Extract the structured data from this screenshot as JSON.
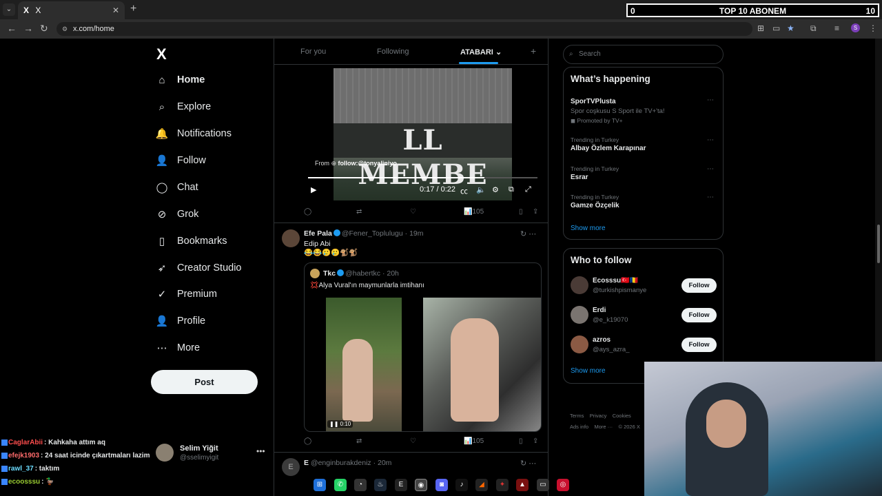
{
  "browser": {
    "tab_title": "X",
    "tab_logo": "X",
    "url": "x.com/home",
    "tab_close": "✕",
    "new_tab": "+",
    "icons": [
      "back-icon",
      "forward-icon",
      "reload-icon",
      "translate-icon",
      "cast-icon",
      "star-icon",
      "extensions-icon",
      "reading-list-icon",
      "profile-icon",
      "menu-icon"
    ]
  },
  "stream_overlay": {
    "left_value": "0",
    "title": "TOP 10 ABONEM",
    "right_value": "10"
  },
  "sidebar": {
    "logo": "X",
    "items": [
      {
        "label": "Home",
        "icon": "home-icon"
      },
      {
        "label": "Explore",
        "icon": "search-icon"
      },
      {
        "label": "Notifications",
        "icon": "bell-icon"
      },
      {
        "label": "Follow",
        "icon": "add-person-icon"
      },
      {
        "label": "Chat",
        "icon": "chat-icon"
      },
      {
        "label": "Grok",
        "icon": "grok-icon"
      },
      {
        "label": "Bookmarks",
        "icon": "bookmark-icon"
      },
      {
        "label": "Creator Studio",
        "icon": "rocket-icon"
      },
      {
        "label": "Premium",
        "icon": "verified-icon"
      },
      {
        "label": "Profile",
        "icon": "person-icon"
      },
      {
        "label": "More",
        "icon": "more-circle-icon"
      }
    ],
    "post_label": "Post",
    "account": {
      "name": "Selim Yiğit",
      "handle": "@sselimyigit",
      "dots": "•••"
    }
  },
  "feed": {
    "tabs": [
      "For you",
      "Following",
      "ATABARI"
    ],
    "tab_plus": "+",
    "video": {
      "banner": "LL MEMBE",
      "from_prefix": "From",
      "from_user": "follow:@tonyaliniyo",
      "time": "0:17 / 0:22",
      "progress": 0.77
    },
    "post1_actions": {
      "views": "105"
    },
    "post2": {
      "name": "Efe Pala",
      "handle": "@Fener_Toplulugu · 19m",
      "text": "Edip Abi",
      "emojis": "😂😂🥲🥲🐒🐒",
      "quote": {
        "name": "Tkc",
        "handle": "@habertkc · 20h",
        "text": "💢Alya Vural'ın maymunlarla imtihanı",
        "video_time": "0:10"
      },
      "views": "105"
    },
    "post3": {
      "name": "E",
      "handle": "@enginburakdeniz · 20m"
    }
  },
  "right": {
    "search_placeholder": "Search",
    "happening_title": "What’s happening",
    "trends": [
      {
        "context": "",
        "title": "SporTVPlusta",
        "sub": "Spor coşkusu S Sport ile TV+'ta!",
        "promo": "Promoted by TV+"
      },
      {
        "context": "Trending in Turkey",
        "title": "Albay Özlem Karapınar"
      },
      {
        "context": "Trending in Turkey",
        "title": "Esrar"
      },
      {
        "context": "Trending in Turkey",
        "title": "Gamze Özçelik"
      }
    ],
    "show_more": "Show more",
    "wtf_title": "Who to follow",
    "wtf": [
      {
        "name": "Ecosssu🇹🇷🇷🇴",
        "handle": "@turkishpismanye",
        "btn": "Follow"
      },
      {
        "name": "Erdi",
        "handle": "@e_k19070",
        "btn": "Follow"
      },
      {
        "name": "azros",
        "handle": "@ays_azra_",
        "btn": "Follow"
      }
    ],
    "wtf_show_more": "Show more",
    "footer_line1": [
      "Terms",
      "Privacy",
      "Cookies"
    ],
    "footer_line2": [
      "Ads info",
      "More ···",
      "© 2026 X"
    ]
  },
  "chat": [
    {
      "user": "CaglarAbii",
      "color": "#ff4d4d",
      "msg": ": Kahkaha attım aq"
    },
    {
      "user": "efejk1903",
      "color": "#ff6b6b",
      "msg": ": 24 saat icinde çıkartmaları lazim"
    },
    {
      "user": "rawl_37",
      "color": "#6bdcff",
      "msg": ": taktım"
    },
    {
      "user": "ecoosssu",
      "color": "#9acd32",
      "msg": ": 🦆"
    }
  ]
}
